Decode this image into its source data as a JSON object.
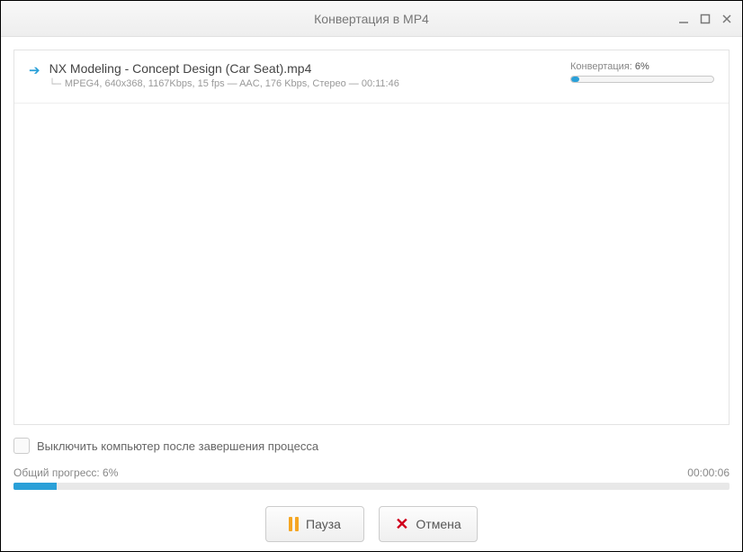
{
  "window": {
    "title": "Конвертация в MP4"
  },
  "file": {
    "name": "NX Modeling - Concept Design (Car Seat).mp4",
    "meta": "MPEG4, 640x368, 1167Kbps, 15 fps — AAC, 176 Kbps, Стерео — 00:11:46",
    "status_label": "Конвертация:",
    "status_pct": "6%",
    "progress_pct": 6
  },
  "bottom": {
    "checkbox_label": "Выключить компьютер после завершения процесса",
    "overall_label": "Общий прогресс: 6%",
    "elapsed": "00:00:06",
    "overall_pct": 6
  },
  "buttons": {
    "pause": "Пауза",
    "cancel": "Отмена"
  }
}
